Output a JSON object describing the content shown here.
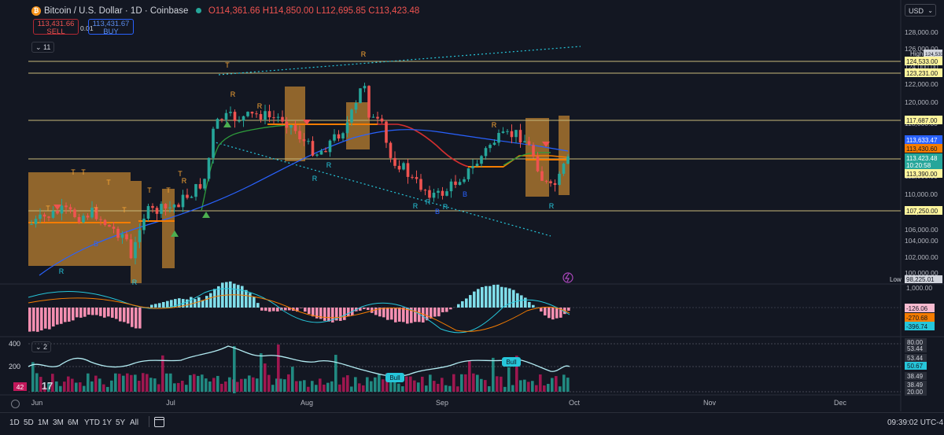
{
  "header": {
    "symbol": "Bitcoin / U.S. Dollar · 1D · Coinbase",
    "open": "O114,361.66",
    "high": "H114,850.00",
    "low": "L112,695.85",
    "close": "C113,423.48",
    "logo_glyph": "₿"
  },
  "trade": {
    "sell_price": "113,431.66",
    "sell_label": "SELL",
    "spread": "0.01",
    "buy_price": "113,431.67",
    "buy_label": "BUY"
  },
  "indicators_toggle": "11",
  "panel2_toggle": "2",
  "currency": "USD",
  "currency_chevron": "⌄",
  "price_scale": {
    "ticks": [
      "128,000.00",
      "126,000.00",
      "124,000.00",
      "122,000.00",
      "120,000.00",
      "118,000.00",
      "116,000.00",
      "114,000.00",
      "112,000.00",
      "110,000.00",
      "108,000.00",
      "106,000.00",
      "104,000.00",
      "102,000.00",
      "100,000.00"
    ],
    "high_label": "High",
    "high_value": "124,533.00",
    "low_label": "Low",
    "low_value": "98,225.01",
    "level_labels": [
      {
        "value": "124,533.00",
        "bg": "#fff59d",
        "fg": "#131722"
      },
      {
        "value": "123,231.00",
        "bg": "#fff59d",
        "fg": "#131722"
      },
      {
        "value": "117,687.00",
        "bg": "#fff59d",
        "fg": "#131722"
      },
      {
        "value": "113,633.47",
        "bg": "#2962ff",
        "fg": "#ffffff"
      },
      {
        "value": "113,430.60",
        "bg": "#f57c00",
        "fg": "#131722"
      },
      {
        "value": "113,423.48",
        "bg": "#26a69a",
        "fg": "#ffffff"
      },
      {
        "value": "10:20:58",
        "bg": "#26a69a",
        "fg": "#ffffff"
      },
      {
        "value": "113,390.00",
        "bg": "#fff59d",
        "fg": "#131722"
      },
      {
        "value": "107,250.00",
        "bg": "#fff59d",
        "fg": "#131722"
      }
    ]
  },
  "macd_scale": {
    "tick": "1,000.00",
    "labels": [
      {
        "value": "-126.06",
        "bg": "#f8bbd0",
        "fg": "#131722"
      },
      {
        "value": "-270.68",
        "bg": "#f57c00",
        "fg": "#131722"
      },
      {
        "value": "-396.74",
        "bg": "#26c6da",
        "fg": "#131722"
      }
    ]
  },
  "rsi_panel": {
    "axis_left": [
      "400",
      "200"
    ],
    "badge_left": "42",
    "scale": [
      "80.00",
      "53.44",
      "53.44",
      "50.67",
      "38.49",
      "38.49",
      "20.00"
    ],
    "bull_labels": [
      "Bull",
      "Bull"
    ]
  },
  "time_axis": [
    "Jun",
    "Jul",
    "Aug",
    "Sep",
    "Oct",
    "Nov",
    "Dec"
  ],
  "timeframes": [
    "1D",
    "5D",
    "1M",
    "3M",
    "6M",
    "YTD",
    "1Y",
    "5Y",
    "All"
  ],
  "clock": "09:39:02 UTC-4",
  "chart_marks": {
    "letters": [
      "T",
      "T",
      "T",
      "T",
      "T",
      "T",
      "T",
      "T",
      "T",
      "T",
      "R",
      "R",
      "R",
      "R",
      "R",
      "R",
      "R",
      "R",
      "R",
      "R",
      "B",
      "B",
      "B",
      "R",
      "R",
      "R"
    ]
  },
  "colors": {
    "background": "#131722",
    "up": "#26a69a",
    "down": "#ef5350",
    "zone": "#f7a534",
    "level_line": "#e8d99a",
    "ma_green": "#2e9e3c",
    "ma_blue": "#2962ff",
    "trend_dotted": "#26c6da"
  }
}
